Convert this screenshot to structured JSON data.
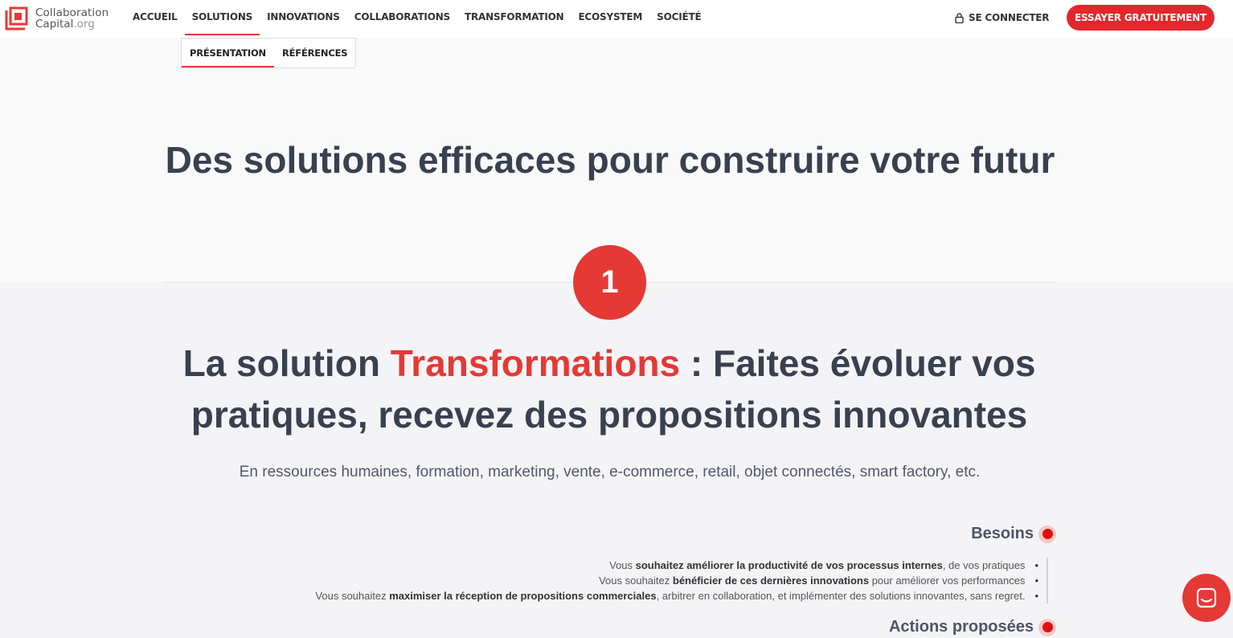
{
  "brand": {
    "line1": "Collaboration",
    "line2": "Capital",
    "line2_suffix": ".org",
    "accent": "#e53935"
  },
  "nav": {
    "items": [
      {
        "label": "ACCUEIL"
      },
      {
        "label": "SOLUTIONS"
      },
      {
        "label": "INNOVATIONS"
      },
      {
        "label": "COLLABORATIONS"
      },
      {
        "label": "TRANSFORMATION"
      },
      {
        "label": "ECOSYSTEM"
      },
      {
        "label": "SOCIÉTÉ"
      }
    ],
    "active": "SOLUTIONS",
    "login": "SE CONNECTER",
    "cta": "ESSAYER GRATUITEMENT"
  },
  "subnav": {
    "items": [
      {
        "label": "PRÉSENTATION"
      },
      {
        "label": "RÉFÉRENCES"
      }
    ],
    "active": "PRÉSENTATION"
  },
  "hero": {
    "title": "Des solutions efficaces pour construire votre futur"
  },
  "step": {
    "number": "1"
  },
  "solution": {
    "title_prefix": "La solution",
    "title_highlight": "Transformations",
    "title_suffix": ": Faites évoluer vos pratiques, recevez des propositions innovantes",
    "subtitle": "En ressources humaines, formation, marketing, vente, e-commerce, retail, objet connectés, smart factory, etc."
  },
  "needs": {
    "heading": "Besoins",
    "items": [
      {
        "pre": "Vous ",
        "bold": "souhaitez améliorer la productivité de vos processus internes",
        "post": ", de vos pratiques"
      },
      {
        "pre": "Vous souhaitez ",
        "bold": "bénéficier de ces dernières innovations",
        "post": " pour améliorer vos performances"
      },
      {
        "pre": "Vous souhaitez ",
        "bold": "maximiser la réception de propositions commerciales",
        "post": ", arbitrer en collaboration, et implémenter des solutions innovantes, sans regret."
      }
    ]
  },
  "actions": {
    "heading": "Actions proposées"
  },
  "icons": {
    "logo": "collaboration-capital-logo",
    "login": "lock-icon",
    "chat": "chat-icon",
    "bullet": "red-dot-icon"
  }
}
